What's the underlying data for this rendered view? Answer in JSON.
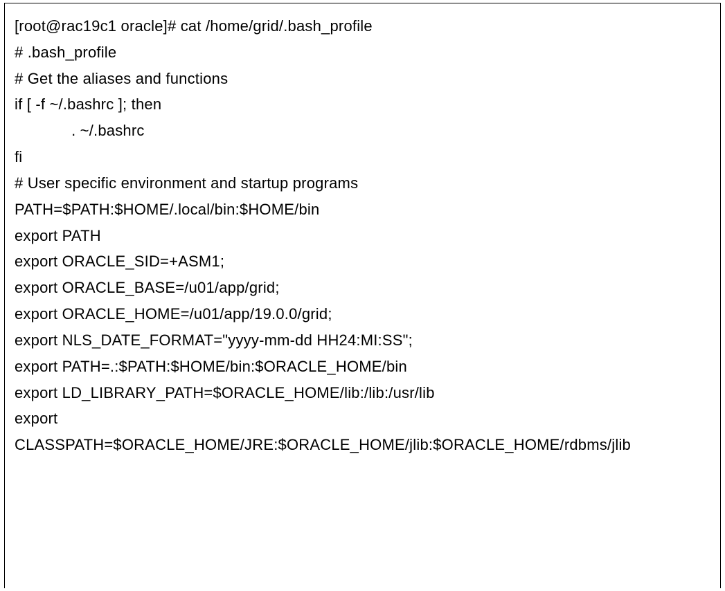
{
  "terminal": {
    "lines": [
      "[root@rac19c1 oracle]# cat /home/grid/.bash_profile",
      "# .bash_profile",
      "",
      "# Get the aliases and functions",
      "if [ -f ~/.bashrc ]; then",
      "             . ~/.bashrc",
      "fi",
      "",
      "# User specific environment and startup programs",
      "",
      "PATH=$PATH:$HOME/.local/bin:$HOME/bin",
      "",
      "export PATH",
      "export ORACLE_SID=+ASM1;",
      "export ORACLE_BASE=/u01/app/grid;",
      "export ORACLE_HOME=/u01/app/19.0.0/grid;",
      "export NLS_DATE_FORMAT=\"yyyy-mm-dd HH24:MI:SS\";",
      "export PATH=.:$PATH:$HOME/bin:$ORACLE_HOME/bin",
      "export LD_LIBRARY_PATH=$ORACLE_HOME/lib:/lib:/usr/lib",
      "export",
      "CLASSPATH=$ORACLE_HOME/JRE:$ORACLE_HOME/jlib:$ORACLE_HOME/rdbms/jlib"
    ]
  }
}
